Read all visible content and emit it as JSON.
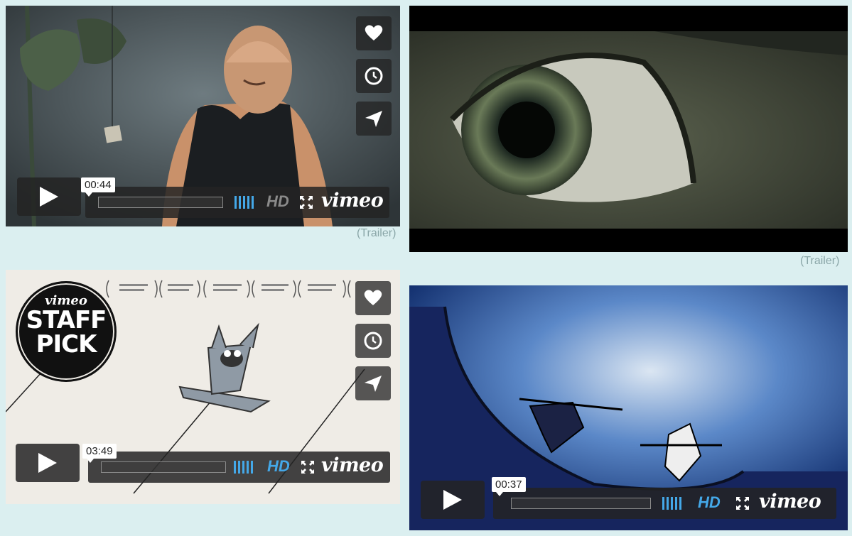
{
  "videos": [
    {
      "timestamp": "00:44",
      "hd": "HD",
      "logo": "vimeo"
    },
    {
      "trailer": "(Trailer)"
    },
    {
      "timestamp": "03:49",
      "hd": "HD",
      "logo": "vimeo"
    },
    {
      "timestamp": "00:37",
      "hd": "HD",
      "logo": "vimeo"
    }
  ],
  "trailer_label": "(Trailer)",
  "staff_pick": {
    "brand": "vimeo",
    "line1": "STAFF",
    "line2": "PICK"
  },
  "colors": {
    "hd_active": "#44a8e8",
    "hd_inactive": "#8a8a8a",
    "volume": "#44a8e8",
    "page_bg": "#dbeff0"
  }
}
